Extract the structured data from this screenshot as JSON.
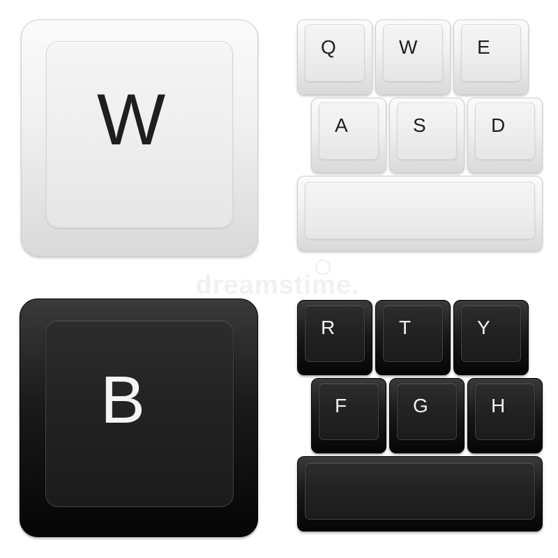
{
  "watermark": {
    "text": "dreamstime."
  },
  "white": {
    "big_key": "W",
    "rows": [
      [
        "Q",
        "W",
        "E"
      ],
      [
        "A",
        "S",
        "D"
      ]
    ],
    "color": "#f0f0f0"
  },
  "black": {
    "big_key": "B",
    "rows": [
      [
        "R",
        "T",
        "Y"
      ],
      [
        "F",
        "G",
        "H"
      ]
    ],
    "color": "#1e1e1e"
  }
}
